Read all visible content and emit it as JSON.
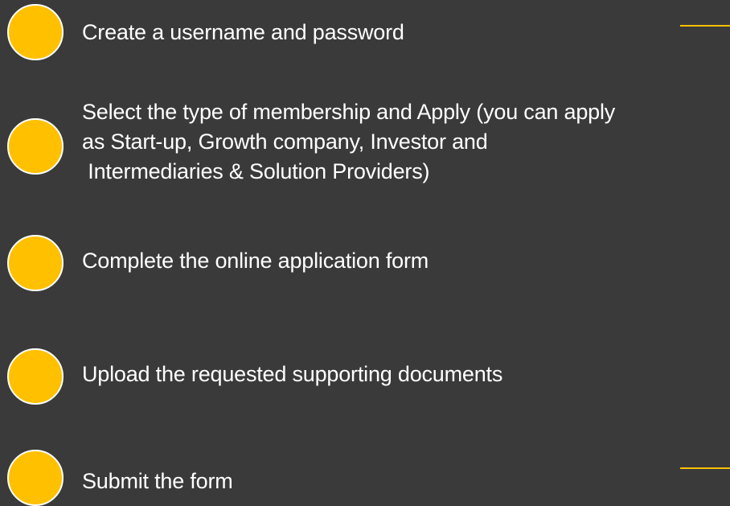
{
  "colors": {
    "background": "#3a3a3a",
    "accent": "#ffc000",
    "text": "#ffffff"
  },
  "steps": [
    {
      "lines": [
        "Create a username and password"
      ]
    },
    {
      "lines": [
        "Select the type of membership and Apply (you can apply",
        "as Start-up, Growth company, Investor and",
        " Intermediaries & Solution Providers)"
      ]
    },
    {
      "lines": [
        "Complete the online application form"
      ]
    },
    {
      "lines": [
        "Upload the requested supporting documents"
      ]
    },
    {
      "lines": [
        "Submit the form"
      ]
    }
  ]
}
